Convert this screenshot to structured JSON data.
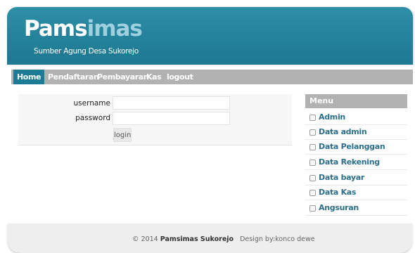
{
  "site": {
    "logo_part1": "Pams",
    "logo_part2": "imas",
    "tagline": "Sumber Agung Desa Sukorejo"
  },
  "nav": {
    "items": [
      "Home",
      "Pendaftaran",
      "Pembayaran",
      "Kas",
      "logout"
    ],
    "active": "Home"
  },
  "login": {
    "username_label": "username",
    "password_label": "password",
    "username_value": "",
    "password_value": "",
    "button_label": "login"
  },
  "menu": {
    "title": "Menu",
    "items": [
      "Admin",
      "Data admin",
      "Data Pelanggan",
      "Data Rekening",
      "Data bayar",
      "Data Kas",
      "Angsuran"
    ]
  },
  "footer": {
    "copyright": "© 2014",
    "org": "Pamsimas Sukorejo",
    "credit": "Design by:konco dewe"
  },
  "colors": {
    "header": "#23819a",
    "nav_active": "#1d7b96",
    "nav_bar": "#b2b2b2",
    "menu_link": "#2a6f8c"
  }
}
